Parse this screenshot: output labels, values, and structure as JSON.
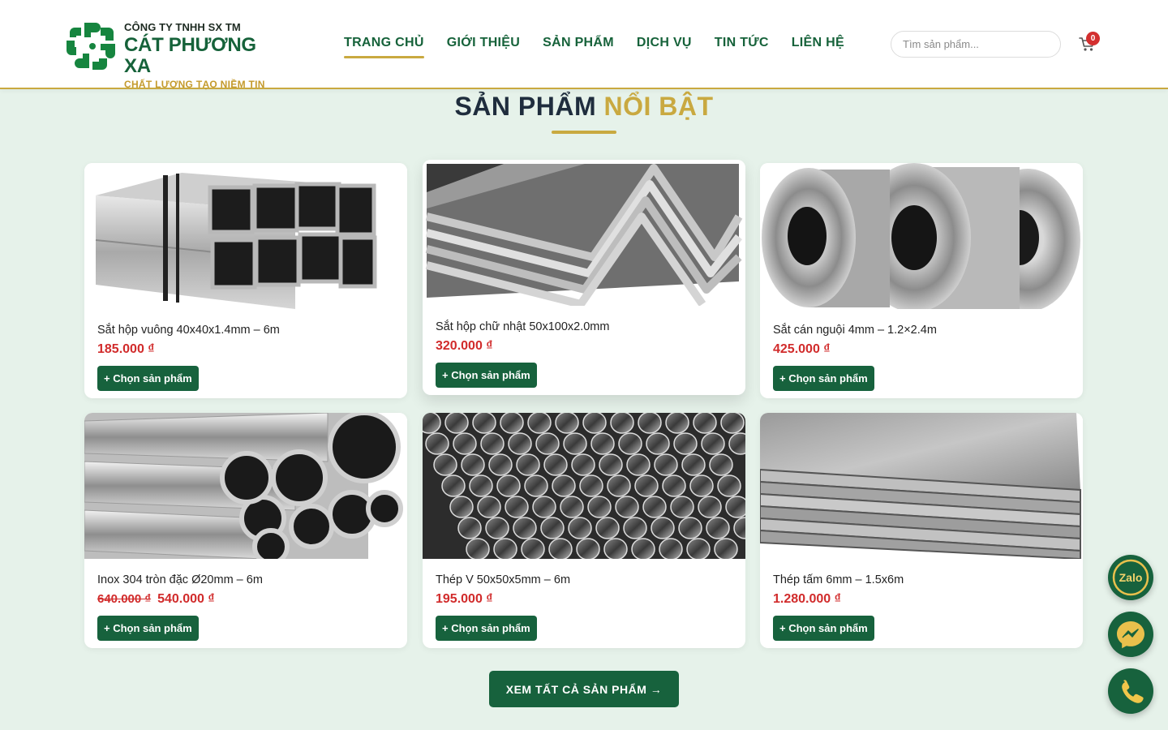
{
  "header": {
    "logo": {
      "company_line": "CÔNG TY TNHH SX TM",
      "name": "CÁT PHƯƠNG XA",
      "slogan": "CHẤT LƯỢNG TẠO NIỀM TIN"
    },
    "nav": [
      {
        "label": "TRANG CHỦ",
        "active": true
      },
      {
        "label": "GIỚI THIỆU",
        "active": false
      },
      {
        "label": "SẢN PHẨM",
        "active": false
      },
      {
        "label": "DỊCH VỤ",
        "active": false
      },
      {
        "label": "TIN TỨC",
        "active": false
      },
      {
        "label": "LIÊN HỆ",
        "active": false
      }
    ],
    "search_placeholder": "Tìm sản phẩm...",
    "cart_icon": "cart-icon",
    "cart_count": "0"
  },
  "section": {
    "title_part1": "SẢN PHẨM",
    "title_part2": "NỔI BẬT"
  },
  "products": [
    {
      "name": "Sắt hộp vuông 40x40x1.4mm – 6m",
      "price": "185.000 ₫",
      "old_price": "",
      "button": "+ Chọn sản phẩm",
      "image": "square-steel-tubes"
    },
    {
      "name": "Sắt hộp chữ nhật 50x100x2.0mm",
      "price": "320.000 ₫",
      "old_price": "",
      "button": "+ Chọn sản phẩm",
      "image": "angle-steel-bars"
    },
    {
      "name": "Sắt cán nguội 4mm – 1.2×2.4m",
      "price": "425.000 ₫",
      "old_price": "",
      "button": "+ Chọn sản phẩm",
      "image": "steel-coils"
    },
    {
      "name": "Inox 304 tròn đặc Ø20mm – 6m",
      "price": "540.000 ₫",
      "old_price": "640.000 ₫",
      "button": "+ Chọn sản phẩm",
      "image": "round-steel-pipes"
    },
    {
      "name": "Thép V 50x50x5mm – 6m",
      "price": "195.000 ₫",
      "old_price": "",
      "button": "+ Chọn sản phẩm",
      "image": "rebar-bundle"
    },
    {
      "name": "Thép tấm 6mm – 1.5x6m",
      "price": "1.280.000 ₫",
      "old_price": "",
      "button": "+ Chọn sản phẩm",
      "image": "steel-plates"
    }
  ],
  "view_all_label": "XEM TẤT CẢ SẢN PHẨM →",
  "floating": {
    "zalo_label": "Zalo",
    "messenger_icon": "messenger-icon",
    "phone_icon": "phone-icon"
  },
  "colors": {
    "brand_green": "#17623d",
    "gold": "#c9a940",
    "price_red": "#d12b2b",
    "background": "#e6f2ea"
  }
}
